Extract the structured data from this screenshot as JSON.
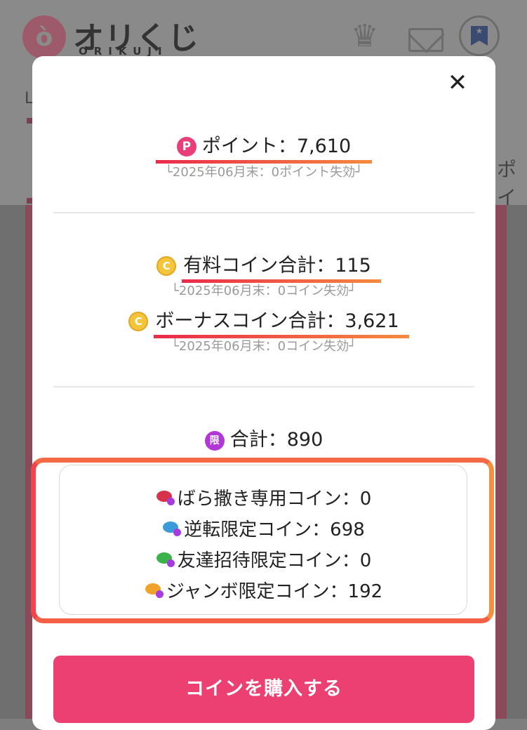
{
  "background": {
    "logo_mark": "ò",
    "logo_text": "オリくじ",
    "logo_subtext": "ORIKUJI",
    "left_tab_fragment": "L",
    "right_tab_fragment": "ポイ",
    "icons": [
      "crown-icon",
      "mail-icon",
      "bookmark-icon"
    ]
  },
  "modal": {
    "close_label": "✕",
    "points": {
      "icon_letter": "P",
      "label": "ポイント：7,610",
      "expiry": "└2025年06月末：0ポイント失効┘"
    },
    "paid_coins": {
      "icon_letter": "C",
      "label": "有料コイン合計：115",
      "expiry": "└2025年06月末：0コイン失効┘"
    },
    "bonus_coins": {
      "icon_letter": "C",
      "label": "ボーナスコイン合計：3,621",
      "expiry": "└2025年06月末：0コイン失効┘"
    },
    "limited_total": {
      "icon_letter": "限",
      "label": "合計：890"
    },
    "limited_coins": [
      {
        "label": "ばら撒き専用コイン：0",
        "color": "#d6334a"
      },
      {
        "label": "逆転限定コイン：698",
        "color": "#3b9ad8"
      },
      {
        "label": "友達招待限定コイン：0",
        "color": "#3bb24a"
      },
      {
        "label": "ジャンボ限定コイン：192",
        "color": "#f0a22a"
      }
    ],
    "buy_button": "コインを購入する"
  },
  "colors": {
    "accent": "#ec3f72",
    "highlight_gradient_start": "#ea2a4b",
    "highlight_gradient_end": "#f58a3e"
  }
}
